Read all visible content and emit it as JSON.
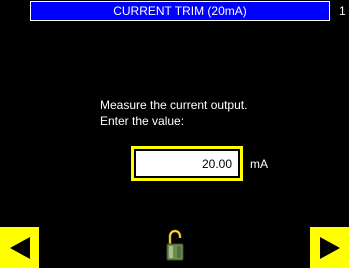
{
  "header": {
    "title": "CURRENT TRIM (20mA)",
    "page_number": "1"
  },
  "instructions": {
    "line1": "Measure the current output.",
    "line2": "Enter the value:"
  },
  "input": {
    "value": "20.00",
    "unit": "mA"
  },
  "navigation": {
    "back_icon": "left-arrow-icon",
    "next_icon": "right-arrow-icon",
    "lock_icon": "unlocked-padlock-icon"
  },
  "colors": {
    "background": "#000000",
    "title_bar": "#0000ff",
    "accent": "#ffff00",
    "text": "#ffffff"
  }
}
